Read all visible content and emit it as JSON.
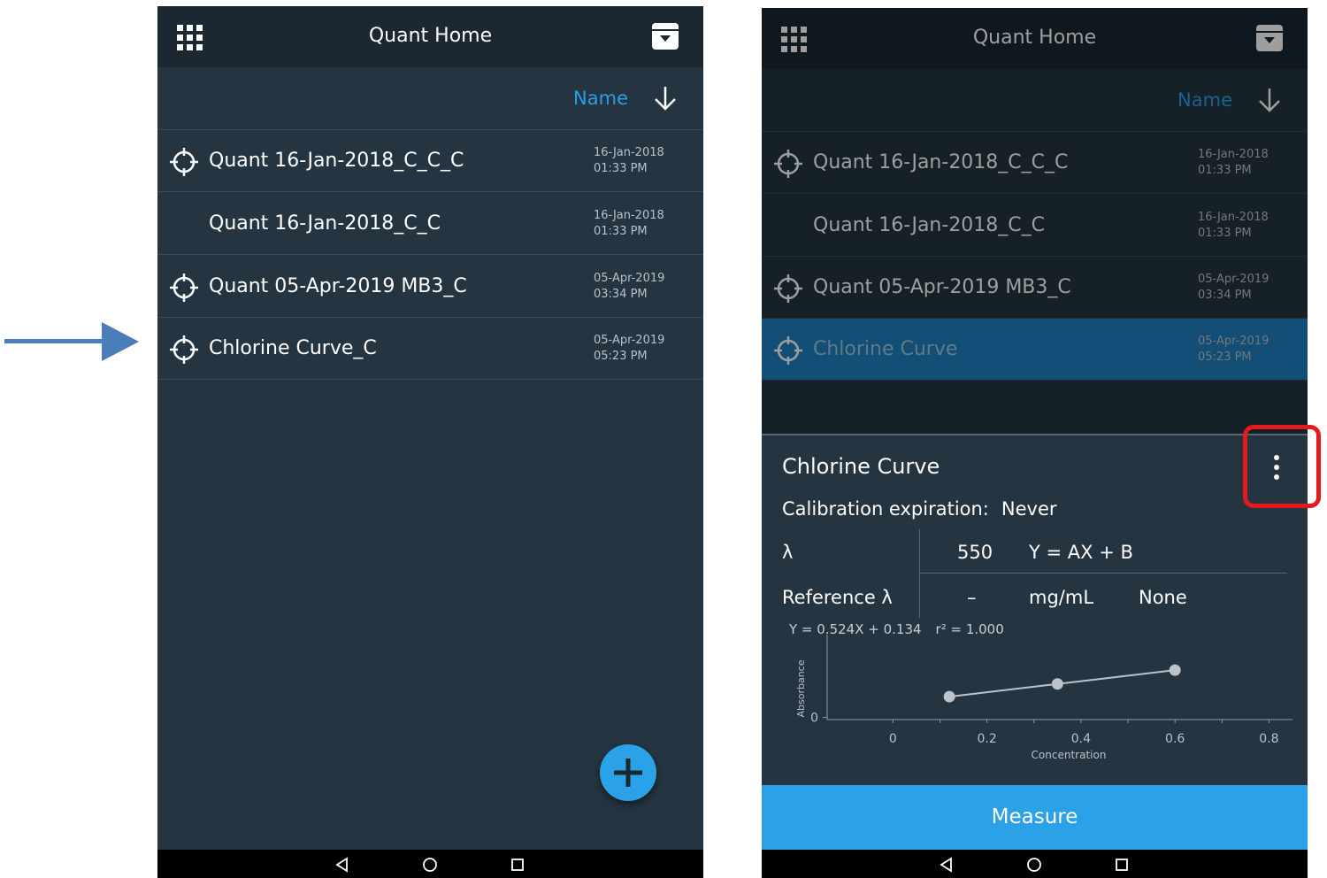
{
  "left_screen": {
    "title": "Quant Home",
    "sort_label": "Name",
    "items": [
      {
        "name": "Quant 16-Jan-2018_C_C_C",
        "date": "16-Jan-2018 01:33 PM",
        "has_target_icon": true
      },
      {
        "name": "Quant 16-Jan-2018_C_C",
        "date": "16-Jan-2018 01:33 PM",
        "has_target_icon": false
      },
      {
        "name": "Quant 05-Apr-2019 MB3_C",
        "date": "05-Apr-2019 03:34 PM",
        "has_target_icon": true
      },
      {
        "name": "Chlorine Curve_C",
        "date": "05-Apr-2019 05:23 PM",
        "has_target_icon": true
      }
    ],
    "fab_icon": "plus-icon"
  },
  "right_screen": {
    "title": "Quant Home",
    "sort_label": "Name",
    "items": [
      {
        "name": "Quant 16-Jan-2018_C_C_C",
        "date": "16-Jan-2018 01:33 PM",
        "has_target_icon": true
      },
      {
        "name": "Quant 16-Jan-2018_C_C",
        "date": "16-Jan-2018 01:33 PM",
        "has_target_icon": false
      },
      {
        "name": "Quant 05-Apr-2019 MB3_C",
        "date": "05-Apr-2019 03:34 PM",
        "has_target_icon": true
      },
      {
        "name": "Chlorine Curve",
        "date": "05-Apr-2019 05:23 PM",
        "has_target_icon": true,
        "selected": true
      }
    ],
    "sheet": {
      "title": "Chlorine Curve",
      "calibration_label": "Calibration expiration:",
      "calibration_value": "Never",
      "lambda_label": "λ",
      "lambda_value": "550",
      "formula": "Y = AX + B",
      "ref_label": "Reference λ",
      "ref_value": "–",
      "unit": "mg/mL",
      "ref_option": "None",
      "equation": "Y = 0.524X + 0.134",
      "r2": "r² = 1.000"
    },
    "measure_label": "Measure"
  },
  "colors": {
    "background": "#243440",
    "appbar": "#1b2832",
    "accent": "#2ba1e8",
    "sort_accent": "#2d9ee6",
    "selected_row": "#1e7fbd",
    "highlight": "#e5191e",
    "arrow": "#4a7ebb"
  },
  "chart_data": {
    "type": "line",
    "x": [
      0.12,
      0.35,
      0.6
    ],
    "y": [
      0.197,
      0.317,
      0.448
    ],
    "xlabel": "Concentration",
    "ylabel": "Absorbance",
    "xticks": [
      "0",
      "0.2",
      "0.4",
      "0.6",
      "0.8"
    ],
    "xtick_values": [
      0,
      0.2,
      0.4,
      0.6,
      0.8
    ],
    "yticks": [
      "0"
    ],
    "xlim": [
      -0.14,
      0.85
    ],
    "ylim": [
      -0.02,
      0.7
    ],
    "grid": false,
    "color": "#bcc4ca"
  }
}
